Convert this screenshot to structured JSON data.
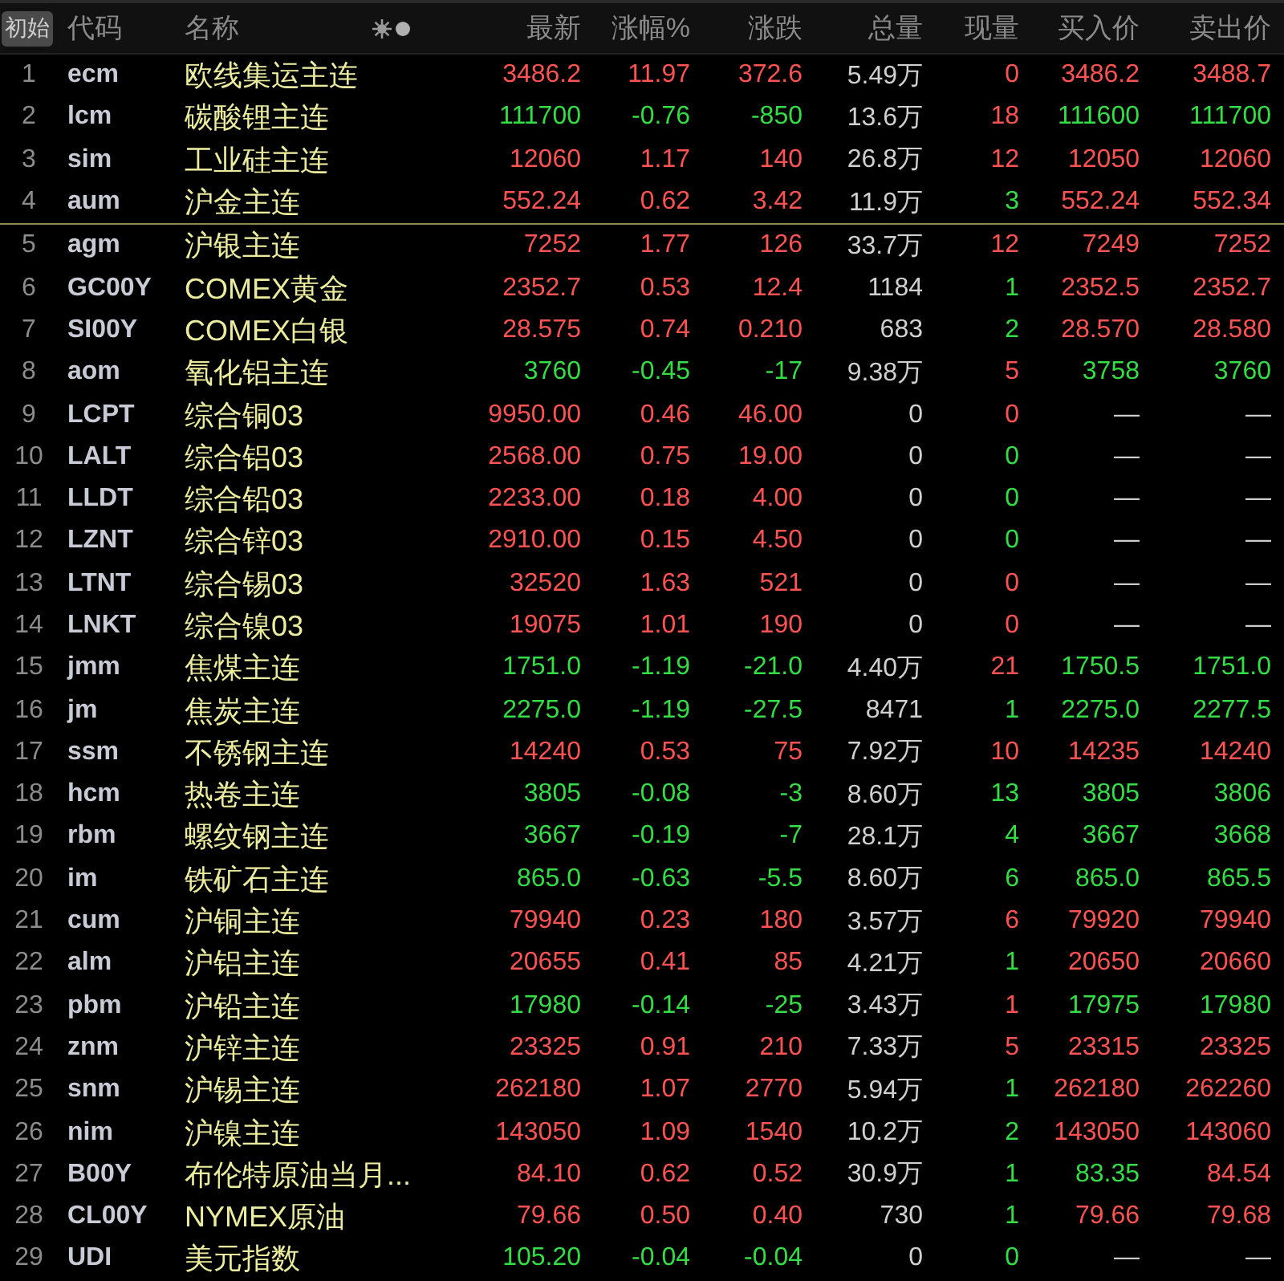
{
  "header": {
    "preset_button": {
      "label": "初始",
      "selected": true
    },
    "columns": [
      "代码",
      "名称",
      "最新",
      "涨幅%",
      "涨跌",
      "总量",
      "现量",
      "买入价",
      "卖出价"
    ]
  },
  "rows": [
    {
      "index": "1",
      "code": "ecm",
      "name": "欧线集运主连",
      "values": [
        {
          "text": "3486.2",
          "color": "#ff5252"
        },
        {
          "text": "11.97",
          "color": "#ff5252"
        },
        {
          "text": "372.6",
          "color": "#ff5252"
        },
        {
          "text": "5.49万",
          "color": "#d0d0d0"
        },
        {
          "text": "0",
          "color": "#ff5252"
        },
        {
          "text": "3486.2",
          "color": "#ff5252"
        },
        {
          "text": "3488.7",
          "color": "#ff5252"
        }
      ]
    },
    {
      "index": "2",
      "code": "lcm",
      "name": "碳酸锂主连",
      "values": [
        {
          "text": "111700",
          "color": "#33dd44"
        },
        {
          "text": "-0.76",
          "color": "#33dd44"
        },
        {
          "text": "-850",
          "color": "#33dd44"
        },
        {
          "text": "13.6万",
          "color": "#d0d0d0"
        },
        {
          "text": "18",
          "color": "#ff5252"
        },
        {
          "text": "111600",
          "color": "#33dd44"
        },
        {
          "text": "111700",
          "color": "#33dd44"
        }
      ]
    },
    {
      "index": "3",
      "code": "sim",
      "name": "工业硅主连",
      "values": [
        {
          "text": "12060",
          "color": "#ff5252"
        },
        {
          "text": "1.17",
          "color": "#ff5252"
        },
        {
          "text": "140",
          "color": "#ff5252"
        },
        {
          "text": "26.8万",
          "color": "#d0d0d0"
        },
        {
          "text": "12",
          "color": "#ff5252"
        },
        {
          "text": "12050",
          "color": "#ff5252"
        },
        {
          "text": "12060",
          "color": "#ff5252"
        }
      ]
    },
    {
      "index": "4",
      "code": "aum",
      "name": "沪金主连",
      "group_end": true,
      "values": [
        {
          "text": "552.24",
          "color": "#ff5252"
        },
        {
          "text": "0.62",
          "color": "#ff5252"
        },
        {
          "text": "3.42",
          "color": "#ff5252"
        },
        {
          "text": "11.9万",
          "color": "#d0d0d0"
        },
        {
          "text": "3",
          "color": "#33dd44"
        },
        {
          "text": "552.24",
          "color": "#ff5252"
        },
        {
          "text": "552.34",
          "color": "#ff5252"
        }
      ]
    },
    {
      "index": "5",
      "code": "agm",
      "name": "沪银主连",
      "values": [
        {
          "text": "7252",
          "color": "#ff5252"
        },
        {
          "text": "1.77",
          "color": "#ff5252"
        },
        {
          "text": "126",
          "color": "#ff5252"
        },
        {
          "text": "33.7万",
          "color": "#d0d0d0"
        },
        {
          "text": "12",
          "color": "#ff5252"
        },
        {
          "text": "7249",
          "color": "#ff5252"
        },
        {
          "text": "7252",
          "color": "#ff5252"
        }
      ]
    },
    {
      "index": "6",
      "code": "GC00Y",
      "name": "COMEX黄金",
      "values": [
        {
          "text": "2352.7",
          "color": "#ff5252"
        },
        {
          "text": "0.53",
          "color": "#ff5252"
        },
        {
          "text": "12.4",
          "color": "#ff5252"
        },
        {
          "text": "1184",
          "color": "#d0d0d0"
        },
        {
          "text": "1",
          "color": "#33dd44"
        },
        {
          "text": "2352.5",
          "color": "#ff5252"
        },
        {
          "text": "2352.7",
          "color": "#ff5252"
        }
      ]
    },
    {
      "index": "7",
      "code": "SI00Y",
      "name": "COMEX白银",
      "values": [
        {
          "text": "28.575",
          "color": "#ff5252"
        },
        {
          "text": "0.74",
          "color": "#ff5252"
        },
        {
          "text": "0.210",
          "color": "#ff5252"
        },
        {
          "text": "683",
          "color": "#d0d0d0"
        },
        {
          "text": "2",
          "color": "#33dd44"
        },
        {
          "text": "28.570",
          "color": "#ff5252"
        },
        {
          "text": "28.580",
          "color": "#ff5252"
        }
      ]
    },
    {
      "index": "8",
      "code": "aom",
      "name": "氧化铝主连",
      "values": [
        {
          "text": "3760",
          "color": "#33dd44"
        },
        {
          "text": "-0.45",
          "color": "#33dd44"
        },
        {
          "text": "-17",
          "color": "#33dd44"
        },
        {
          "text": "9.38万",
          "color": "#d0d0d0"
        },
        {
          "text": "5",
          "color": "#ff5252"
        },
        {
          "text": "3758",
          "color": "#33dd44"
        },
        {
          "text": "3760",
          "color": "#33dd44"
        }
      ]
    },
    {
      "index": "9",
      "code": "LCPT",
      "name": "综合铜03",
      "values": [
        {
          "text": "9950.00",
          "color": "#ff5252"
        },
        {
          "text": "0.46",
          "color": "#ff5252"
        },
        {
          "text": "46.00",
          "color": "#ff5252"
        },
        {
          "text": "0",
          "color": "#d0d0d0"
        },
        {
          "text": "0",
          "color": "#ff5252"
        },
        {
          "text": "—",
          "color": "#d0d0d0"
        },
        {
          "text": "—",
          "color": "#d0d0d0"
        }
      ]
    },
    {
      "index": "10",
      "code": "LALT",
      "name": "综合铝03",
      "values": [
        {
          "text": "2568.00",
          "color": "#ff5252"
        },
        {
          "text": "0.75",
          "color": "#ff5252"
        },
        {
          "text": "19.00",
          "color": "#ff5252"
        },
        {
          "text": "0",
          "color": "#d0d0d0"
        },
        {
          "text": "0",
          "color": "#33dd44"
        },
        {
          "text": "—",
          "color": "#d0d0d0"
        },
        {
          "text": "—",
          "color": "#d0d0d0"
        }
      ]
    },
    {
      "index": "11",
      "code": "LLDT",
      "name": "综合铅03",
      "values": [
        {
          "text": "2233.00",
          "color": "#ff5252"
        },
        {
          "text": "0.18",
          "color": "#ff5252"
        },
        {
          "text": "4.00",
          "color": "#ff5252"
        },
        {
          "text": "0",
          "color": "#d0d0d0"
        },
        {
          "text": "0",
          "color": "#33dd44"
        },
        {
          "text": "—",
          "color": "#d0d0d0"
        },
        {
          "text": "—",
          "color": "#d0d0d0"
        }
      ]
    },
    {
      "index": "12",
      "code": "LZNT",
      "name": "综合锌03",
      "values": [
        {
          "text": "2910.00",
          "color": "#ff5252"
        },
        {
          "text": "0.15",
          "color": "#ff5252"
        },
        {
          "text": "4.50",
          "color": "#ff5252"
        },
        {
          "text": "0",
          "color": "#d0d0d0"
        },
        {
          "text": "0",
          "color": "#33dd44"
        },
        {
          "text": "—",
          "color": "#d0d0d0"
        },
        {
          "text": "—",
          "color": "#d0d0d0"
        }
      ]
    },
    {
      "index": "13",
      "code": "LTNT",
      "name": "综合锡03",
      "values": [
        {
          "text": "32520",
          "color": "#ff5252"
        },
        {
          "text": "1.63",
          "color": "#ff5252"
        },
        {
          "text": "521",
          "color": "#ff5252"
        },
        {
          "text": "0",
          "color": "#d0d0d0"
        },
        {
          "text": "0",
          "color": "#ff5252"
        },
        {
          "text": "—",
          "color": "#d0d0d0"
        },
        {
          "text": "—",
          "color": "#d0d0d0"
        }
      ]
    },
    {
      "index": "14",
      "code": "LNKT",
      "name": "综合镍03",
      "values": [
        {
          "text": "19075",
          "color": "#ff5252"
        },
        {
          "text": "1.01",
          "color": "#ff5252"
        },
        {
          "text": "190",
          "color": "#ff5252"
        },
        {
          "text": "0",
          "color": "#d0d0d0"
        },
        {
          "text": "0",
          "color": "#ff5252"
        },
        {
          "text": "—",
          "color": "#d0d0d0"
        },
        {
          "text": "—",
          "color": "#d0d0d0"
        }
      ]
    },
    {
      "index": "15",
      "code": "jmm",
      "name": "焦煤主连",
      "values": [
        {
          "text": "1751.0",
          "color": "#33dd44"
        },
        {
          "text": "-1.19",
          "color": "#33dd44"
        },
        {
          "text": "-21.0",
          "color": "#33dd44"
        },
        {
          "text": "4.40万",
          "color": "#d0d0d0"
        },
        {
          "text": "21",
          "color": "#ff5252"
        },
        {
          "text": "1750.5",
          "color": "#33dd44"
        },
        {
          "text": "1751.0",
          "color": "#33dd44"
        }
      ]
    },
    {
      "index": "16",
      "code": "jm",
      "name": "焦炭主连",
      "values": [
        {
          "text": "2275.0",
          "color": "#33dd44"
        },
        {
          "text": "-1.19",
          "color": "#33dd44"
        },
        {
          "text": "-27.5",
          "color": "#33dd44"
        },
        {
          "text": "8471",
          "color": "#d0d0d0"
        },
        {
          "text": "1",
          "color": "#33dd44"
        },
        {
          "text": "2275.0",
          "color": "#33dd44"
        },
        {
          "text": "2277.5",
          "color": "#33dd44"
        }
      ]
    },
    {
      "index": "17",
      "code": "ssm",
      "name": "不锈钢主连",
      "values": [
        {
          "text": "14240",
          "color": "#ff5252"
        },
        {
          "text": "0.53",
          "color": "#ff5252"
        },
        {
          "text": "75",
          "color": "#ff5252"
        },
        {
          "text": "7.92万",
          "color": "#d0d0d0"
        },
        {
          "text": "10",
          "color": "#ff5252"
        },
        {
          "text": "14235",
          "color": "#ff5252"
        },
        {
          "text": "14240",
          "color": "#ff5252"
        }
      ]
    },
    {
      "index": "18",
      "code": "hcm",
      "name": "热卷主连",
      "values": [
        {
          "text": "3805",
          "color": "#33dd44"
        },
        {
          "text": "-0.08",
          "color": "#33dd44"
        },
        {
          "text": "-3",
          "color": "#33dd44"
        },
        {
          "text": "8.60万",
          "color": "#d0d0d0"
        },
        {
          "text": "13",
          "color": "#33dd44"
        },
        {
          "text": "3805",
          "color": "#33dd44"
        },
        {
          "text": "3806",
          "color": "#33dd44"
        }
      ]
    },
    {
      "index": "19",
      "code": "rbm",
      "name": "螺纹钢主连",
      "values": [
        {
          "text": "3667",
          "color": "#33dd44"
        },
        {
          "text": "-0.19",
          "color": "#33dd44"
        },
        {
          "text": "-7",
          "color": "#33dd44"
        },
        {
          "text": "28.1万",
          "color": "#d0d0d0"
        },
        {
          "text": "4",
          "color": "#33dd44"
        },
        {
          "text": "3667",
          "color": "#33dd44"
        },
        {
          "text": "3668",
          "color": "#33dd44"
        }
      ]
    },
    {
      "index": "20",
      "code": "im",
      "name": "铁矿石主连",
      "values": [
        {
          "text": "865.0",
          "color": "#33dd44"
        },
        {
          "text": "-0.63",
          "color": "#33dd44"
        },
        {
          "text": "-5.5",
          "color": "#33dd44"
        },
        {
          "text": "8.60万",
          "color": "#d0d0d0"
        },
        {
          "text": "6",
          "color": "#33dd44"
        },
        {
          "text": "865.0",
          "color": "#33dd44"
        },
        {
          "text": "865.5",
          "color": "#33dd44"
        }
      ]
    },
    {
      "index": "21",
      "code": "cum",
      "name": "沪铜主连",
      "values": [
        {
          "text": "79940",
          "color": "#ff5252"
        },
        {
          "text": "0.23",
          "color": "#ff5252"
        },
        {
          "text": "180",
          "color": "#ff5252"
        },
        {
          "text": "3.57万",
          "color": "#d0d0d0"
        },
        {
          "text": "6",
          "color": "#ff5252"
        },
        {
          "text": "79920",
          "color": "#ff5252"
        },
        {
          "text": "79940",
          "color": "#ff5252"
        }
      ]
    },
    {
      "index": "22",
      "code": "alm",
      "name": "沪铝主连",
      "values": [
        {
          "text": "20655",
          "color": "#ff5252"
        },
        {
          "text": "0.41",
          "color": "#ff5252"
        },
        {
          "text": "85",
          "color": "#ff5252"
        },
        {
          "text": "4.21万",
          "color": "#d0d0d0"
        },
        {
          "text": "1",
          "color": "#33dd44"
        },
        {
          "text": "20650",
          "color": "#ff5252"
        },
        {
          "text": "20660",
          "color": "#ff5252"
        }
      ]
    },
    {
      "index": "23",
      "code": "pbm",
      "name": "沪铅主连",
      "values": [
        {
          "text": "17980",
          "color": "#33dd44"
        },
        {
          "text": "-0.14",
          "color": "#33dd44"
        },
        {
          "text": "-25",
          "color": "#33dd44"
        },
        {
          "text": "3.43万",
          "color": "#d0d0d0"
        },
        {
          "text": "1",
          "color": "#ff5252"
        },
        {
          "text": "17975",
          "color": "#33dd44"
        },
        {
          "text": "17980",
          "color": "#33dd44"
        }
      ]
    },
    {
      "index": "24",
      "code": "znm",
      "name": "沪锌主连",
      "values": [
        {
          "text": "23325",
          "color": "#ff5252"
        },
        {
          "text": "0.91",
          "color": "#ff5252"
        },
        {
          "text": "210",
          "color": "#ff5252"
        },
        {
          "text": "7.33万",
          "color": "#d0d0d0"
        },
        {
          "text": "5",
          "color": "#ff5252"
        },
        {
          "text": "23315",
          "color": "#ff5252"
        },
        {
          "text": "23325",
          "color": "#ff5252"
        }
      ]
    },
    {
      "index": "25",
      "code": "snm",
      "name": "沪锡主连",
      "values": [
        {
          "text": "262180",
          "color": "#ff5252"
        },
        {
          "text": "1.07",
          "color": "#ff5252"
        },
        {
          "text": "2770",
          "color": "#ff5252"
        },
        {
          "text": "5.94万",
          "color": "#d0d0d0"
        },
        {
          "text": "1",
          "color": "#33dd44"
        },
        {
          "text": "262180",
          "color": "#ff5252"
        },
        {
          "text": "262260",
          "color": "#ff5252"
        }
      ]
    },
    {
      "index": "26",
      "code": "nim",
      "name": "沪镍主连",
      "values": [
        {
          "text": "143050",
          "color": "#ff5252"
        },
        {
          "text": "1.09",
          "color": "#ff5252"
        },
        {
          "text": "1540",
          "color": "#ff5252"
        },
        {
          "text": "10.2万",
          "color": "#d0d0d0"
        },
        {
          "text": "2",
          "color": "#33dd44"
        },
        {
          "text": "143050",
          "color": "#ff5252"
        },
        {
          "text": "143060",
          "color": "#ff5252"
        }
      ]
    },
    {
      "index": "27",
      "code": "B00Y",
      "name": "布伦特原油当月...",
      "values": [
        {
          "text": "84.10",
          "color": "#ff5252"
        },
        {
          "text": "0.62",
          "color": "#ff5252"
        },
        {
          "text": "0.52",
          "color": "#ff5252"
        },
        {
          "text": "30.9万",
          "color": "#d0d0d0"
        },
        {
          "text": "1",
          "color": "#33dd44"
        },
        {
          "text": "83.35",
          "color": "#33dd44"
        },
        {
          "text": "84.54",
          "color": "#ff5252"
        }
      ]
    },
    {
      "index": "28",
      "code": "CL00Y",
      "name": "NYMEX原油",
      "values": [
        {
          "text": "79.66",
          "color": "#ff5252"
        },
        {
          "text": "0.50",
          "color": "#ff5252"
        },
        {
          "text": "0.40",
          "color": "#ff5252"
        },
        {
          "text": "730",
          "color": "#d0d0d0"
        },
        {
          "text": "1",
          "color": "#33dd44"
        },
        {
          "text": "79.66",
          "color": "#ff5252"
        },
        {
          "text": "79.68",
          "color": "#ff5252"
        }
      ]
    },
    {
      "index": "29",
      "code": "UDI",
      "name": "美元指数",
      "values": [
        {
          "text": "105.20",
          "color": "#33dd44"
        },
        {
          "text": "-0.04",
          "color": "#33dd44"
        },
        {
          "text": "-0.04",
          "color": "#33dd44"
        },
        {
          "text": "0",
          "color": "#d0d0d0"
        },
        {
          "text": "0",
          "color": "#33dd44"
        },
        {
          "text": "—",
          "color": "#d0d0d0"
        },
        {
          "text": "—",
          "color": "#d0d0d0"
        }
      ]
    }
  ]
}
